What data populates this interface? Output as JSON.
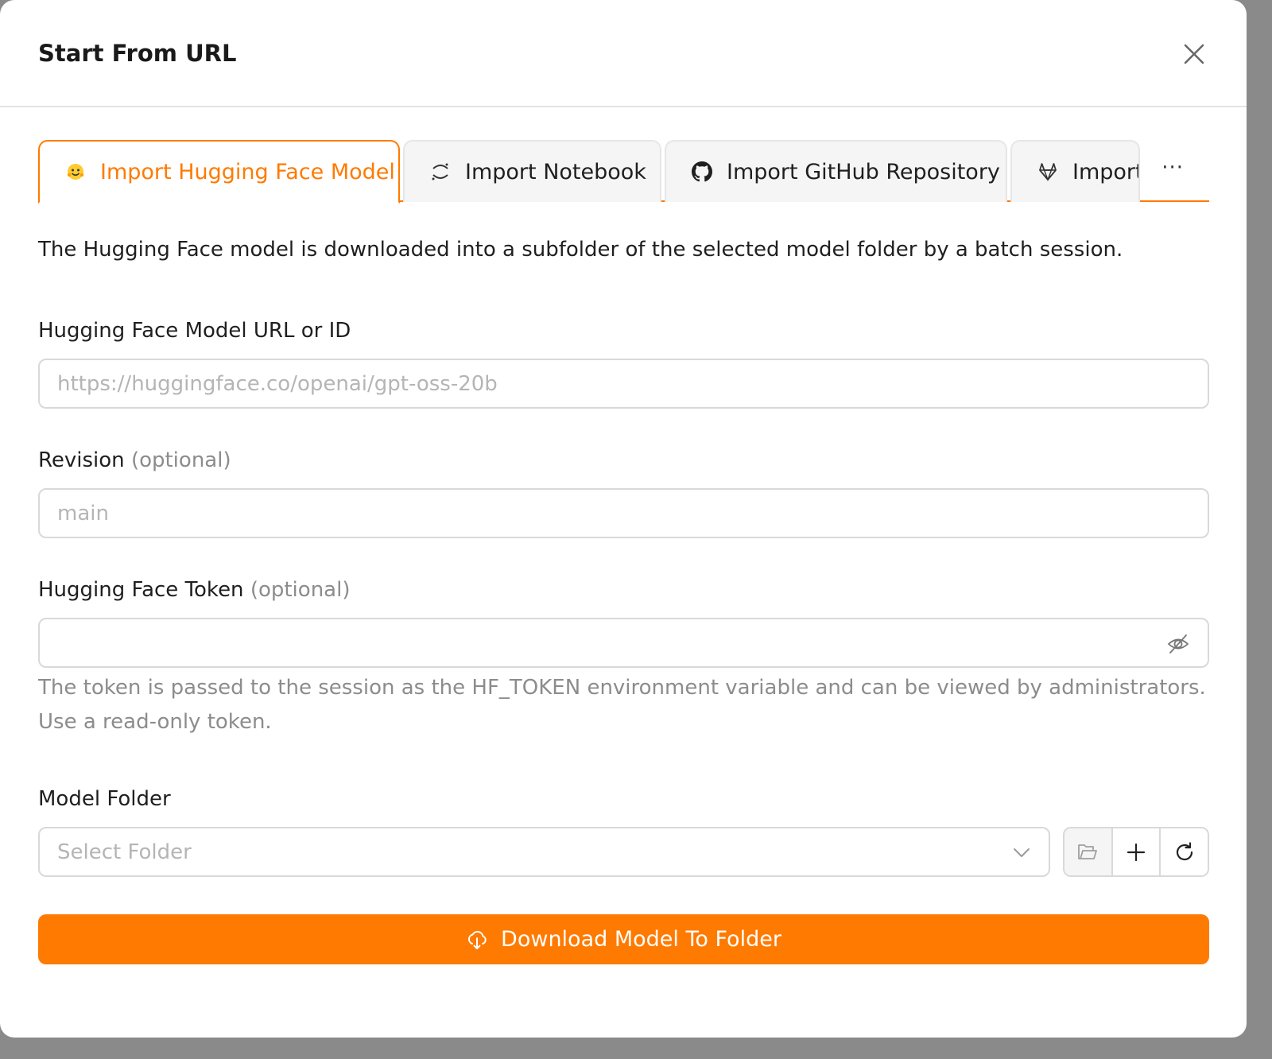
{
  "dialog": {
    "title": "Start From URL"
  },
  "tabs": [
    {
      "label": "Import Hugging Face Model",
      "icon": "hugging-face-icon",
      "active": true
    },
    {
      "label": "Import Notebook",
      "icon": "jupyter-icon",
      "active": false
    },
    {
      "label": "Import GitHub Repository",
      "icon": "github-icon",
      "active": false
    },
    {
      "label": "Import",
      "icon": "gitlab-icon",
      "active": false
    }
  ],
  "tabs_more": "···",
  "description": "The Hugging Face model is downloaded into a subfolder of the selected model folder by a batch session.",
  "fields": {
    "model_url": {
      "label": "Hugging Face Model URL or ID",
      "placeholder": "https://huggingface.co/openai/gpt-oss-20b",
      "value": ""
    },
    "revision": {
      "label": "Revision",
      "optional": "(optional)",
      "placeholder": "main",
      "value": ""
    },
    "token": {
      "label": "Hugging Face Token",
      "optional": "(optional)",
      "value": "",
      "help": "The token is passed to the session as the HF_TOKEN environment variable and can be viewed by administrators. Use a read-only token."
    },
    "model_folder": {
      "label": "Model Folder",
      "placeholder": "Select Folder"
    }
  },
  "submit_label": "Download Model To Folder",
  "colors": {
    "accent": "#ff7a00",
    "border": "#d9d9d9",
    "muted": "#8c8c8c"
  }
}
